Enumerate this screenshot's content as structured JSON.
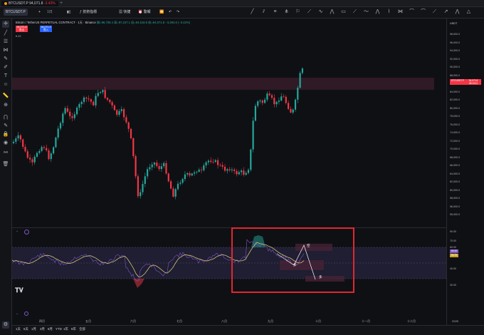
{
  "tab": {
    "symbol": "BTCUSDT.P",
    "price": "94,071.8",
    "change": "-3.42%"
  },
  "toolbar": {
    "symbol": "BTCUSDT.P",
    "items": [
      "+",
      "1日",
      "指标",
      "技術指標",
      "快捷",
      "警報"
    ]
  },
  "legend": {
    "title": "Bitcoin / TetherUS PERPETUAL CONTRACT · 1天 · Binance",
    "ohlc": "開=96,708.4  高=97,247.1  低=94,518.5  收=94,071.8  −3,394.6 (−3.42%)",
    "badge_sell": "94,071.8",
    "badge_sell_sub": "賣出",
    "badge_buy": "94,071.9",
    "badge_buy_sub": "買入",
    "indicator_count": "22"
  },
  "price_axis": {
    "currency": "USDT",
    "labels": [
      "98,000.0",
      "96,000.0",
      "94,000.0",
      "92,000.0",
      "90,000.0",
      "88,000.0",
      "86,000.0",
      "84,000.0",
      "82,000.0",
      "80,000.0",
      "78,000.0",
      "76,000.0",
      "74,000.0",
      "72,000.0",
      "70,000.0",
      "68,000.0",
      "66,000.0",
      "64,000.0",
      "62,000.0",
      "60,000.0",
      "58,000.0",
      "56,000.0",
      "55,000.0"
    ],
    "current_tag": "BTCUSDT.P",
    "current_price": "94,071.8",
    "current_time": "08:13:11"
  },
  "rsi_axis": {
    "labels": [
      "90.00",
      "70.00",
      "60.00",
      "50.00",
      "40.00",
      "30.00"
    ],
    "value1": "58.50",
    "value2": "55.93"
  },
  "time_axis": [
    "四月",
    "五月",
    "六月",
    "七月",
    "八月",
    "九月",
    "十月",
    "十一月",
    "十二月",
    "2025"
  ],
  "annotations": {
    "box1": "空",
    "box2": "多",
    "box3": "多"
  },
  "timeframes": [
    "1天",
    "5天",
    "1月",
    "3月",
    "6月",
    "YTD",
    "1年",
    "5年",
    "全部"
  ],
  "colors": {
    "up": "#26a69a",
    "down": "#f23645",
    "rsi": "#7e57c2",
    "ma": "#d1c17a",
    "zone": "#4a2335",
    "annot": "#e3262f"
  }
}
